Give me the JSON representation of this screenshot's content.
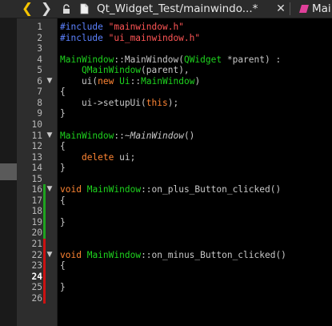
{
  "toolbar": {
    "tab_title": "Qt_Widget_Test/mainwindo...*",
    "close_glyph": "✕",
    "symbol_label": "Mai",
    "icons": [
      "back-icon",
      "forward-icon",
      "lock-icon",
      "document-icon",
      "symbol-icon"
    ],
    "accent_color": "#f5c400"
  },
  "editor": {
    "current_line": 24,
    "colors": {
      "keyword": "#ff8533",
      "preprocessor": "#5c82ff",
      "string": "#ff5555",
      "type": "#1ed41e",
      "plain": "#c8c8c8",
      "added_marker": "#1fa31f",
      "modified_marker": "#cc1111"
    },
    "line_numbers": [
      "1",
      "2",
      "3",
      "4",
      "5",
      "6",
      "7",
      "8",
      "9",
      "10",
      "11",
      "12",
      "13",
      "14",
      "15",
      "16",
      "17",
      "18",
      "19",
      "20",
      "21",
      "22",
      "23",
      "24",
      "25",
      "26"
    ],
    "fold_lines": [
      6,
      11,
      16,
      22
    ],
    "added_lines": [
      16,
      17,
      18,
      19,
      20
    ],
    "modified_lines": [
      21,
      22,
      23,
      24,
      25,
      26
    ],
    "lines": [
      [
        {
          "t": "#include ",
          "c": "pp"
        },
        {
          "t": "\"mainwindow.h\"",
          "c": "st"
        }
      ],
      [
        {
          "t": "#include ",
          "c": "pp"
        },
        {
          "t": "\"ui_mainwindow.h\"",
          "c": "st"
        }
      ],
      [],
      [
        {
          "t": "MainWindow",
          "c": "cls"
        },
        {
          "t": "::",
          "c": "pl"
        },
        {
          "t": "MainWindow",
          "c": "pl"
        },
        {
          "t": "(",
          "c": "pl"
        },
        {
          "t": "QWidget",
          "c": "cls"
        },
        {
          "t": " *parent) :",
          "c": "pl"
        }
      ],
      [
        {
          "t": "    ",
          "c": "pl"
        },
        {
          "t": "QMainWindow",
          "c": "cls"
        },
        {
          "t": "(parent),",
          "c": "pl"
        }
      ],
      [
        {
          "t": "    ui(",
          "c": "pl"
        },
        {
          "t": "new",
          "c": "k"
        },
        {
          "t": " ",
          "c": "pl"
        },
        {
          "t": "Ui",
          "c": "cls"
        },
        {
          "t": "::",
          "c": "pl"
        },
        {
          "t": "MainWindow",
          "c": "cls"
        },
        {
          "t": ")",
          "c": "pl"
        }
      ],
      [
        {
          "t": "{",
          "c": "pl"
        }
      ],
      [
        {
          "t": "    ui->setupUi(",
          "c": "pl"
        },
        {
          "t": "this",
          "c": "k"
        },
        {
          "t": ");",
          "c": "pl"
        }
      ],
      [
        {
          "t": "}",
          "c": "pl"
        }
      ],
      [],
      [
        {
          "t": "MainWindow",
          "c": "cls"
        },
        {
          "t": "::~",
          "c": "pl"
        },
        {
          "t": "MainWindow",
          "c": "it"
        },
        {
          "t": "()",
          "c": "pl"
        }
      ],
      [
        {
          "t": "{",
          "c": "pl"
        }
      ],
      [
        {
          "t": "    ",
          "c": "pl"
        },
        {
          "t": "delete",
          "c": "k"
        },
        {
          "t": " ui;",
          "c": "pl"
        }
      ],
      [
        {
          "t": "}",
          "c": "pl"
        }
      ],
      [],
      [
        {
          "t": "void",
          "c": "k"
        },
        {
          "t": " ",
          "c": "pl"
        },
        {
          "t": "MainWindow",
          "c": "cls"
        },
        {
          "t": "::on_plus_Button_clicked()",
          "c": "pl"
        }
      ],
      [
        {
          "t": "{",
          "c": "pl"
        }
      ],
      [],
      [
        {
          "t": "}",
          "c": "pl"
        }
      ],
      [],
      [],
      [
        {
          "t": "void",
          "c": "k"
        },
        {
          "t": " ",
          "c": "pl"
        },
        {
          "t": "MainWindow",
          "c": "cls"
        },
        {
          "t": "::on_minus_Button_clicked()",
          "c": "pl"
        }
      ],
      [
        {
          "t": "{",
          "c": "pl"
        }
      ],
      [],
      [
        {
          "t": "}",
          "c": "pl"
        }
      ],
      []
    ]
  }
}
